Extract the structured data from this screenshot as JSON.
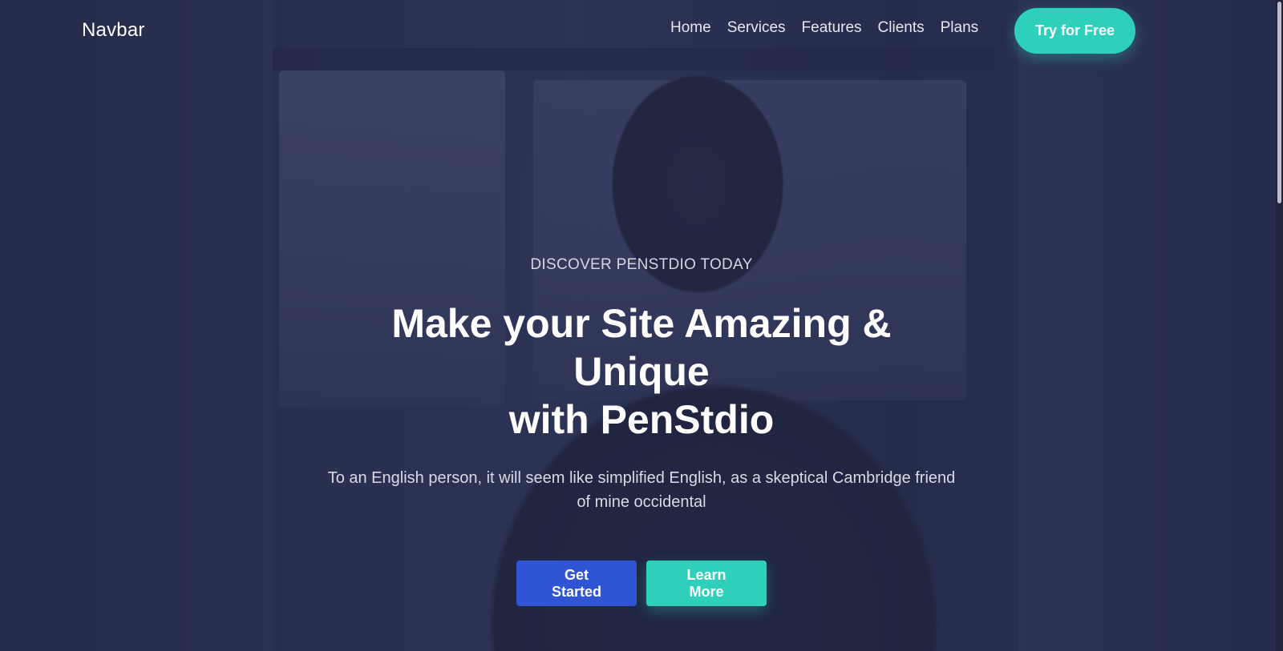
{
  "navbar": {
    "brand": "Navbar",
    "links": [
      "Home",
      "Services",
      "Features",
      "Clients",
      "Plans"
    ],
    "cta_label": "Try for Free"
  },
  "hero": {
    "eyebrow": "DISCOVER PENSTDIO TODAY",
    "title_line1": "Make your Site Amazing & Unique",
    "title_line2": "with PenStdio",
    "description_line1": "To an English person, it will seem like simplified English, as a skeptical Cambridge friend",
    "description_line2": "of mine occidental",
    "primary_button": "Get Started",
    "secondary_button": "Learn More"
  },
  "colors": {
    "accent_teal": "#2fd0bb",
    "primary_blue": "#2f55d4",
    "overlay": "#1c2240"
  }
}
